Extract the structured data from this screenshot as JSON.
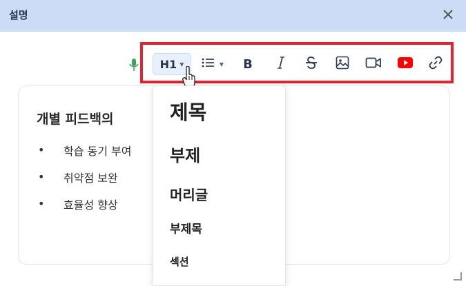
{
  "header": {
    "title": "설명"
  },
  "toolbar": {
    "heading_label": "H1",
    "icons": [
      "mic-icon",
      "list-icon",
      "bold-icon",
      "italic-icon",
      "strikethrough-icon",
      "image-icon",
      "video-icon",
      "youtube-icon",
      "link-icon"
    ],
    "bold_label": "B"
  },
  "content": {
    "title": "개별 피드백의 ",
    "items": [
      "학습 동기 부여",
      "취약점 보완",
      "효율성 향상"
    ],
    "bullet": "•"
  },
  "heading_menu": {
    "options": [
      "제목",
      "부제",
      "머리글",
      "부제목",
      "섹션"
    ]
  },
  "colors": {
    "highlight_box": "#e42230",
    "header_bg": "#cddcf6",
    "youtube": "#ff0000",
    "mic": "#3aa655"
  }
}
